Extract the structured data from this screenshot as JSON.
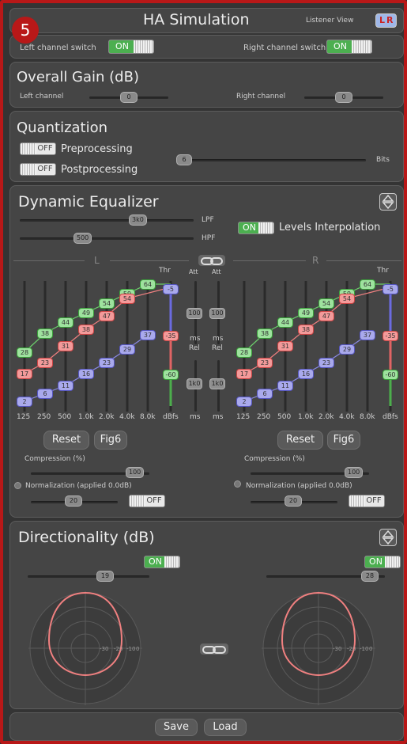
{
  "step_badge": "5",
  "header": {
    "title": "HA Simulation",
    "listener_view": "Listener View",
    "lr_left": "L",
    "lr_right": "R"
  },
  "channel_switch": {
    "left_label": "Left channel switch",
    "right_label": "Right channel switch",
    "left_state": "ON",
    "right_state": "ON"
  },
  "overall_gain": {
    "title": "Overall Gain (dB)",
    "left_label": "Left channel",
    "right_label": "Right channel",
    "left_value": "0",
    "right_value": "0"
  },
  "quantization": {
    "title": "Quantization",
    "pre_state": "OFF",
    "pre_label": "Preprocessing",
    "post_state": "OFF",
    "post_label": "Postprocessing",
    "bits_value": "6",
    "bits_label": "Bits"
  },
  "dyn_eq": {
    "title": "Dynamic Equalizer",
    "lpf_value": "3k0",
    "lpf_label": "LPF",
    "hpf_value": "500",
    "hpf_label": "HPF",
    "levels_state": "ON",
    "levels_label": "Levels Interpolation",
    "left_channel": "L",
    "right_channel": "R",
    "thr": "Thr",
    "att": "Att",
    "ms": "ms",
    "rel": "Rel",
    "att_value": "100",
    "rel_value": "1k0",
    "freqs": [
      "125",
      "250",
      "500",
      "1.0k",
      "2.0k",
      "4.0k",
      "8.0k",
      "dBfs"
    ],
    "green_values": [
      "28",
      "38",
      "44",
      "49",
      "54",
      "59",
      "64"
    ],
    "red_values": [
      "17",
      "23",
      "31",
      "38",
      "47",
      "54"
    ],
    "blue_values": [
      "2",
      "6",
      "11",
      "16",
      "23",
      "29",
      "37"
    ],
    "thr_values": [
      "-5",
      "-35",
      "-60"
    ],
    "reset_label": "Reset",
    "fig6_label": "Fig6",
    "compression_label": "Compression (%)",
    "compression_value": "100",
    "normalization_label": "Normalization (applied 0.0dB)",
    "normalization_value": "20",
    "normalization_state": "OFF"
  },
  "directionality": {
    "title": "Directionality (dB)",
    "left_state": "ON",
    "right_state": "ON",
    "left_value": "19",
    "right_value": "28",
    "polar_labels": [
      "-30",
      "-20",
      "-10",
      "0"
    ]
  },
  "footer": {
    "save_label": "Save",
    "load_label": "Load"
  },
  "colors": {
    "border": "#b81818",
    "green": "#4caf50",
    "red_curve": "#f08080",
    "blue": "#8080e0"
  }
}
